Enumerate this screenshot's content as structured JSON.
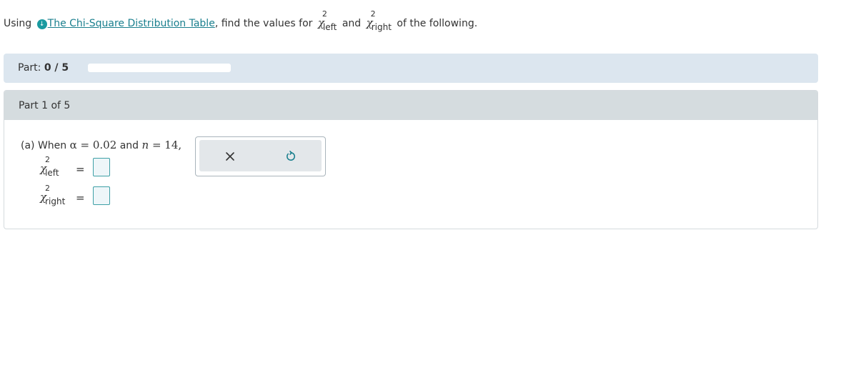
{
  "intro": {
    "prefix": "Using",
    "link_text": "The Chi-Square Distribution Table",
    "middle": ", find the values for",
    "chi_left_sup": "2",
    "chi_left_sub": "left",
    "and_text": "and",
    "chi_right_sup": "2",
    "chi_right_sub": "right",
    "suffix": "of the following."
  },
  "progress": {
    "label": "Part:",
    "value_text": "0 / 5",
    "fraction": 0
  },
  "part": {
    "header": "Part 1 of 5",
    "question_prefix": "(a) When",
    "alpha_expr": "α = 0.02",
    "and_text": "and",
    "n_var": "n",
    "n_expr": " = 14,",
    "rows": [
      {
        "sup": "2",
        "sub": "left",
        "equals": "=",
        "value": ""
      },
      {
        "sup": "2",
        "sub": "right",
        "equals": "=",
        "value": ""
      }
    ]
  },
  "toolbar": {
    "clear_icon": "close-icon",
    "reset_icon": "undo-icon"
  },
  "colors": {
    "accent": "#1a9aa0",
    "link": "#1a7f8e",
    "progress_panel": "#dce6ef",
    "part_header": "#d5dcdf"
  }
}
